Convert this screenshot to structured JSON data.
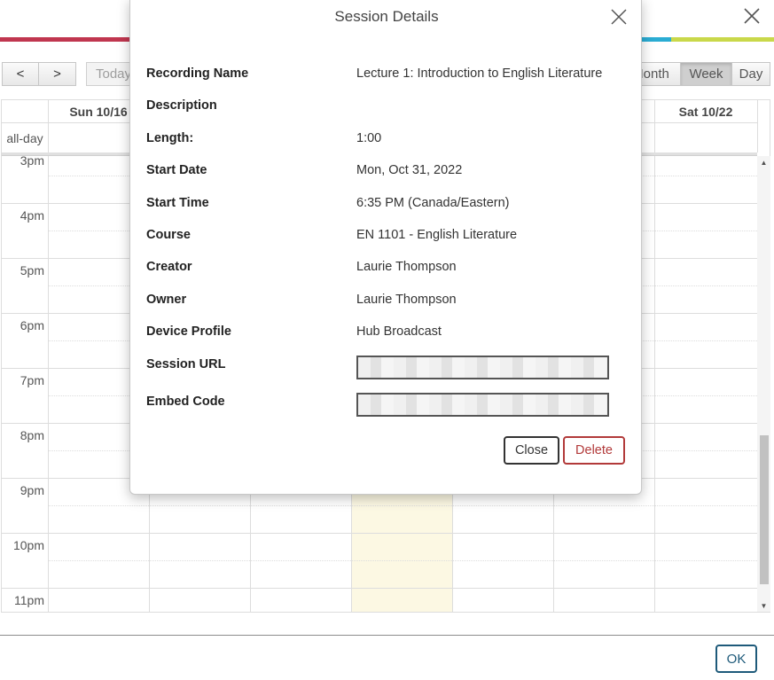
{
  "colors": {
    "stripe": [
      "#c0364f",
      "#c0364f",
      "#c0364f",
      "#c0364f",
      "#e9842f",
      "#f1b52d",
      "#f1e04b",
      "#e99bc7",
      "#8b3c8c",
      "#3b3f91",
      "#2aacd3",
      "#c9d84a",
      "#2aacd3",
      "#c9d84a",
      "#c9d84a"
    ],
    "today_bg": "#fcf8e3",
    "ok_accent": "#1e5a7a",
    "delete_accent": "#b23a3a"
  },
  "toolbar": {
    "prev_icon": "chevron-left-icon",
    "next_icon": "chevron-right-icon",
    "prev_glyph": "<",
    "next_glyph": ">",
    "today_label": "Today",
    "views": [
      {
        "label": "Month",
        "active": false
      },
      {
        "label": "Week",
        "active": true
      },
      {
        "label": "Day",
        "active": false
      }
    ]
  },
  "calendar": {
    "day_headers": [
      {
        "label": "Sun 10/16"
      },
      {
        "label": ""
      },
      {
        "label": ""
      },
      {
        "label": ""
      },
      {
        "label": ""
      },
      {
        "label": ""
      },
      {
        "label": "Sat 10/22"
      }
    ],
    "allday_label": "all-day",
    "time_labels": [
      "3pm",
      "4pm",
      "5pm",
      "6pm",
      "7pm",
      "8pm",
      "9pm",
      "10pm",
      "11pm"
    ]
  },
  "modal": {
    "title": "Session Details",
    "fields": [
      {
        "label": "Recording Name",
        "value": "Lecture 1: Introduction to English Literature"
      },
      {
        "label": "Description",
        "value": ""
      },
      {
        "label": "Length:",
        "value": "1:00"
      },
      {
        "label": "Start Date",
        "value": "Mon, Oct 31, 2022"
      },
      {
        "label": "Start Time",
        "value": "6:35 PM (Canada/Eastern)"
      },
      {
        "label": "Course",
        "value": "EN 1101 - English Literature"
      },
      {
        "label": "Creator",
        "value": "Laurie Thompson"
      },
      {
        "label": "Owner",
        "value": "Laurie Thompson"
      },
      {
        "label": "Device Profile",
        "value": "Hub Broadcast"
      }
    ],
    "session_url_label": "Session URL",
    "embed_code_label": "Embed Code",
    "close_label": "Close",
    "delete_label": "Delete"
  },
  "footer": {
    "ok_label": "OK"
  }
}
